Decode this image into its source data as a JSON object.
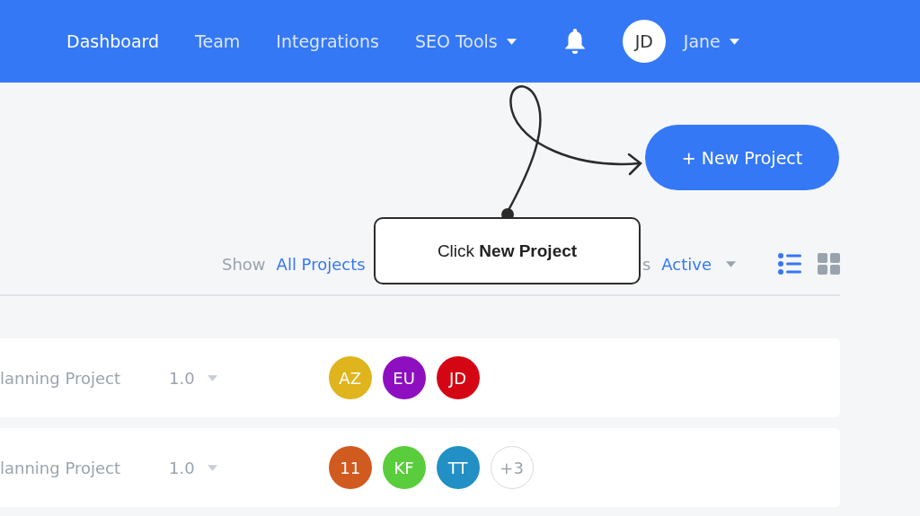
{
  "nav": {
    "items": [
      {
        "label": "Dashboard",
        "selected": true,
        "dropdown": false
      },
      {
        "label": "Team",
        "selected": false,
        "dropdown": false
      },
      {
        "label": "Integrations",
        "selected": false,
        "dropdown": false
      },
      {
        "label": "SEO Tools",
        "selected": false,
        "dropdown": true
      }
    ],
    "user": {
      "initials": "JD",
      "name": "Jane"
    }
  },
  "new_project_button": "+ New Project",
  "filters": {
    "show_label": "Show",
    "show_value": "All Projects",
    "status_label": "s",
    "status_value": "Active"
  },
  "views": [
    {
      "kind": "list",
      "selected": true
    },
    {
      "kind": "grid",
      "selected": false
    }
  ],
  "rows": [
    {
      "name": "lanning Project",
      "version": "1.0",
      "members": [
        {
          "initials": "AZ",
          "color": "#e0b41c"
        },
        {
          "initials": "EU",
          "color": "#8e0fc0"
        },
        {
          "initials": "JD",
          "color": "#d40614"
        }
      ]
    },
    {
      "name": "lanning Project",
      "version": "1.0",
      "members": [
        {
          "initials": "11",
          "color": "#d15a1f"
        },
        {
          "initials": "KF",
          "color": "#5acd3c"
        },
        {
          "initials": "TT",
          "color": "#2290c4"
        }
      ],
      "more": "+3"
    }
  ],
  "callout": "Click **New Project**"
}
